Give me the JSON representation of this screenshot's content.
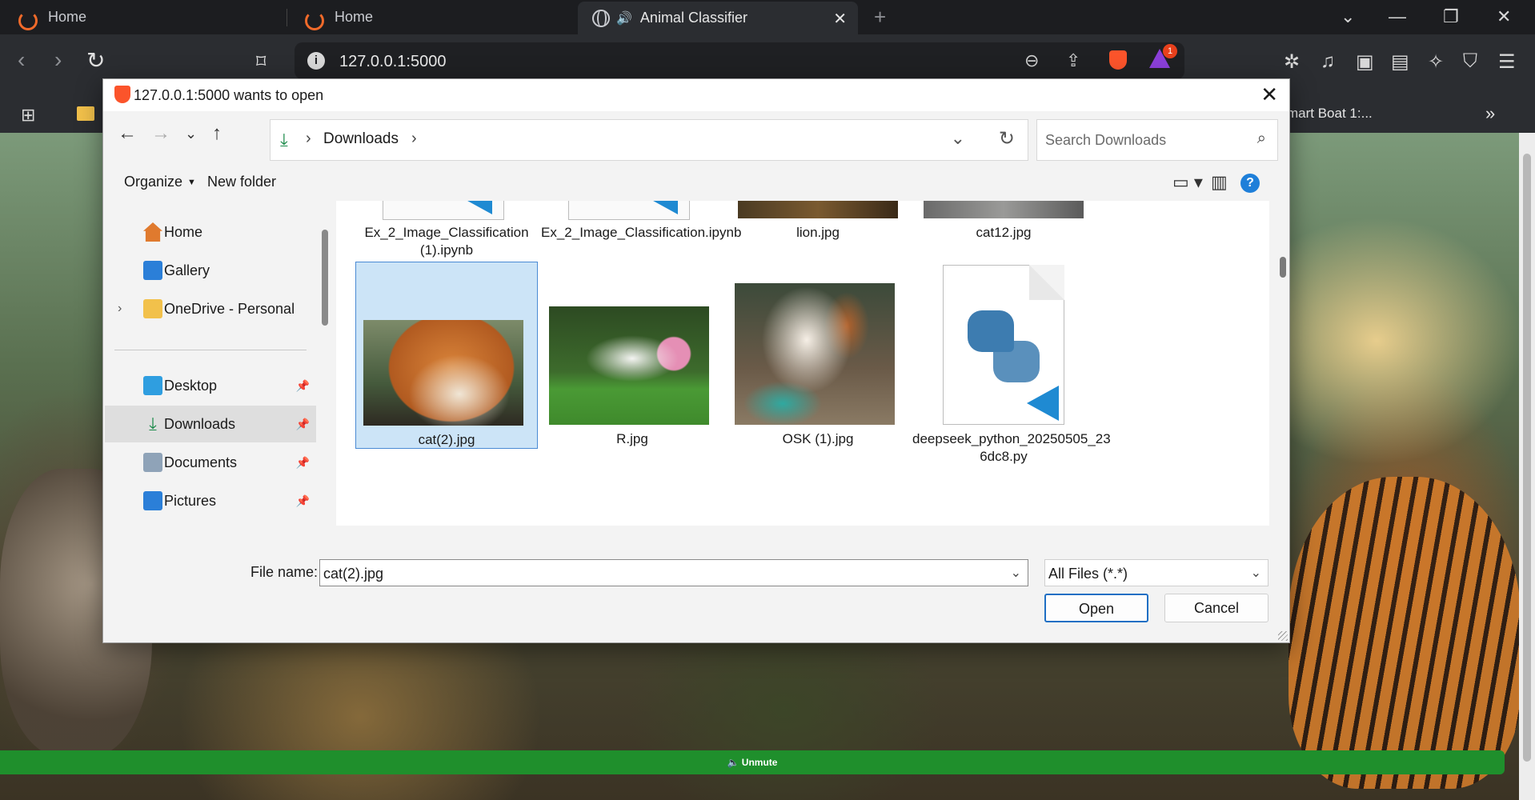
{
  "browser": {
    "tabs": [
      {
        "label": "Home"
      },
      {
        "label": "Home"
      },
      {
        "label": "Animal Classifier",
        "active": true
      }
    ],
    "url": "127.0.0.1:5000",
    "rewards_badge": "1",
    "bookmark_overflow_text": "mart Boat 1:..."
  },
  "page": {
    "unmute_label": "Unmute"
  },
  "dialog": {
    "title": "127.0.0.1:5000 wants to open",
    "breadcrumb": {
      "folder": "Downloads"
    },
    "search": {
      "placeholder": "Search Downloads"
    },
    "commands": {
      "organize": "Organize",
      "new_folder": "New folder",
      "help": "?"
    },
    "nav_pane": [
      {
        "label": "Home",
        "icon": "home-icon"
      },
      {
        "label": "Gallery",
        "icon": "gallery-icon"
      },
      {
        "label": "OneDrive - Personal",
        "icon": "folder-icon",
        "expandable": true
      },
      {
        "label": "Desktop",
        "icon": "desktop-icon",
        "pinned": true
      },
      {
        "label": "Downloads",
        "icon": "download-icon",
        "pinned": true,
        "selected": true
      },
      {
        "label": "Documents",
        "icon": "documents-icon",
        "pinned": true
      },
      {
        "label": "Pictures",
        "icon": "pictures-icon",
        "pinned": true
      }
    ],
    "files": [
      {
        "name_line1": "Ex_2_Image_Classification",
        "name_line2": "(1).ipynb",
        "kind": "notebook"
      },
      {
        "name_line1": "Ex_2_Image_Classification.ipynb",
        "name_line2": "",
        "kind": "notebook"
      },
      {
        "name_line1": "lion.jpg",
        "name_line2": "",
        "kind": "image"
      },
      {
        "name_line1": "cat12.jpg",
        "name_line2": "",
        "kind": "image"
      },
      {
        "name_line1": "cat(2).jpg",
        "name_line2": "",
        "kind": "image",
        "selected": true
      },
      {
        "name_line1": "R.jpg",
        "name_line2": "",
        "kind": "image"
      },
      {
        "name_line1": "OSK (1).jpg",
        "name_line2": "",
        "kind": "image"
      },
      {
        "name_line1": "deepseek_python_20250505_23",
        "name_line2": "6dc8.py",
        "kind": "python"
      }
    ],
    "file_name": {
      "label": "File name:",
      "value": "cat(2).jpg"
    },
    "file_type": {
      "value": "All Files (*.*)"
    },
    "buttons": {
      "open": "Open",
      "cancel": "Cancel"
    }
  },
  "colors": {
    "accent": "#1f6fc4",
    "selection": "#cce4f7",
    "unmute_bar": "#1f8f2c",
    "brave": "#fb542b"
  }
}
